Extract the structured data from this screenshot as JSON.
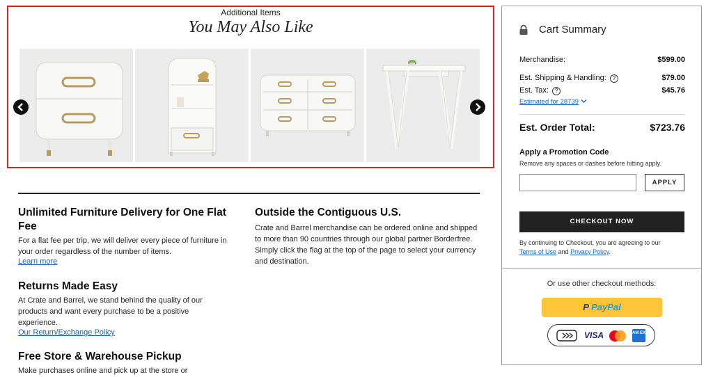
{
  "carousel": {
    "eyebrow": "Additional Items",
    "title": "You May Also Like",
    "products": [
      {
        "icon": "nightstand-image"
      },
      {
        "icon": "bookcase-image"
      },
      {
        "icon": "dresser-image"
      },
      {
        "icon": "desk-image"
      }
    ]
  },
  "info": {
    "delivery": {
      "title": "Unlimited Furniture Delivery for One Flat Fee",
      "text": "For a flat fee per trip, we will deliver every piece of furniture in your order regardless of the number of items.",
      "link": "Learn more"
    },
    "returns": {
      "title": "Returns Made Easy",
      "text": "At Crate and Barrel, we stand behind the quality of our products and want every purchase to be a positive experience.",
      "link": "Our Return/Exchange Policy"
    },
    "pickup": {
      "title": "Free Store & Warehouse Pickup",
      "text": "Make purchases online and pick up at the store or"
    },
    "international": {
      "title": "Outside the Contiguous U.S.",
      "text": "Crate and Barrel merchandise can be ordered online and shipped to more than 90 countries through our global partner Borderfree. Simply click the flag at the top of the page to select your currency and destination."
    }
  },
  "summary": {
    "title": "Cart Summary",
    "merch_label": "Merchandise:",
    "merch_value": "$599.00",
    "ship_label": "Est. Shipping & Handling:",
    "ship_value": "$79.00",
    "tax_label": "Est. Tax:",
    "tax_value": "$45.76",
    "estimated_for": "Estimated for 28739",
    "total_label": "Est. Order Total:",
    "total_value": "$723.76",
    "promo_title": "Apply a Promotion Code",
    "promo_hint": "Remove any spaces or dashes before hitting apply.",
    "promo_value": "",
    "apply_label": "APPLY",
    "checkout_label": "CHECKOUT NOW",
    "terms_prefix": "By continuing to Checkout, you are agreeing to our",
    "terms_link": "Terms of Use",
    "terms_and": "and",
    "privacy_link": "Privacy Policy",
    "terms_end": "."
  },
  "alt_checkout": {
    "label": "Or use other checkout methods:",
    "paypal_p": "P",
    "paypal_brand": "PayPal",
    "visa": "VISA",
    "amex": "AM EX"
  },
  "colors": {
    "highlight_border": "#e02020",
    "paypal_yellow": "#ffc439",
    "paypal_blue": "#253b80",
    "link_blue": "#1a5fb4",
    "checkout_bg": "#222222"
  }
}
